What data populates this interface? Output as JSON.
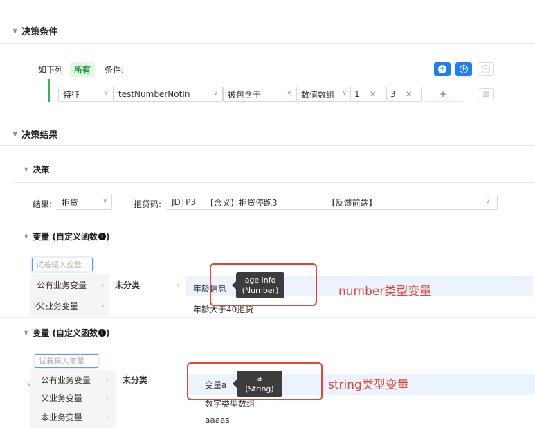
{
  "decision_condition": {
    "title": "决策条件",
    "prefix": "如下列",
    "mode": "所有",
    "suffix": "条件:",
    "row": {
      "field_type": "特征",
      "field_name": "testNumberNotIn",
      "operator": "被包含于",
      "value_type": "数值数组",
      "values": [
        "1",
        "3"
      ],
      "add_symbol": "+"
    }
  },
  "decision_result": {
    "title": "决策结果",
    "decision": {
      "title": "决策",
      "result_label": "结果:",
      "result_value": "拒贷",
      "reject_code_label": "拒贷码:",
      "reject_code_value": "JDTP3",
      "meaning_text": "【含义】拒贷停跑3",
      "feedback_text": "【反馈前端】"
    },
    "variable_panel_1": {
      "title": "变量 (自定义函数",
      "info_icon": "info-icon",
      "search_placeholder": "试着输入变量",
      "col1": [
        "公有业务变量",
        "父业务变量"
      ],
      "col2": [
        "未分类"
      ],
      "col3": [
        "年龄信息",
        "年龄大于40拒贷"
      ],
      "tooltip_line1": "age info",
      "tooltip_line2": "(Number)",
      "annotation": "number类型变量"
    },
    "variable_panel_2": {
      "title": "变量 (自定义函数",
      "info_icon": "info-icon",
      "search_placeholder": "试着输入变量",
      "col1": [
        "公有业务变量",
        "父业务变量",
        "本业务变量"
      ],
      "col2": [
        "未分类"
      ],
      "col3": [
        "变量a",
        "数字类型数组",
        "aaaas"
      ],
      "tooltip_line1": "a",
      "tooltip_line2": "(String)",
      "annotation": "string类型变量"
    }
  },
  "colors": {
    "accent_blue": "#1e7ff0",
    "tag_green": "#1a9e3b",
    "annotation_red": "#e8442f"
  }
}
